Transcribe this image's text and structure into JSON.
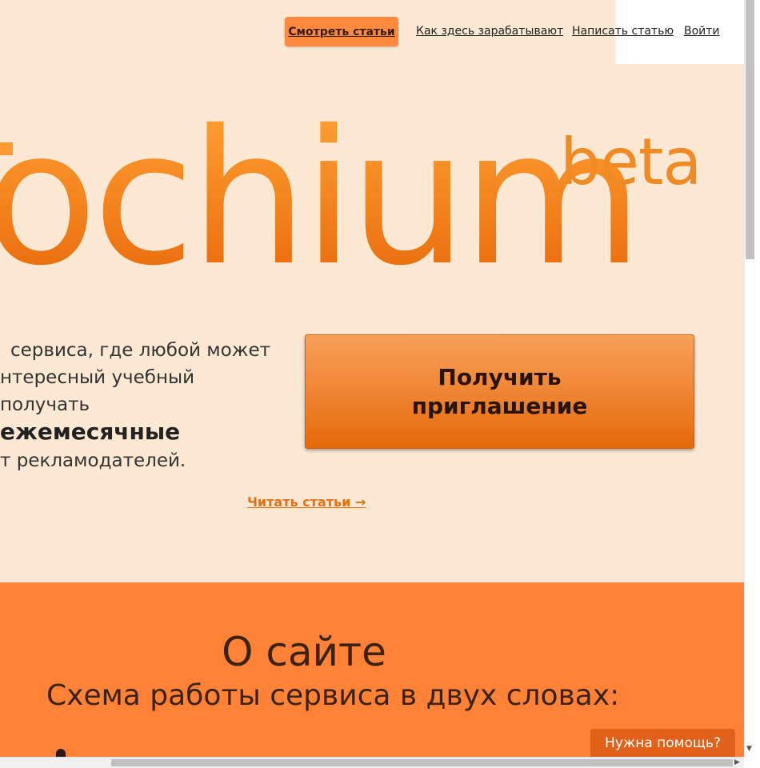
{
  "nav": {
    "active_label": "Смотреть статьи",
    "items": [
      {
        "label": "Как здесь зарабатывают"
      },
      {
        "label": "Написать статью"
      },
      {
        "label": "Войти"
      }
    ]
  },
  "hero": {
    "logo_text": "ochium",
    "beta_label": "beta",
    "intro_line1": "сервиса, где любой может",
    "intro_line2": "нтересный учебный",
    "intro_line3_prefix": "получать ",
    "intro_line3_bold": "ежемесячные",
    "intro_line4": "т рекламодателей.",
    "invite_button_label": "Получить приглашение",
    "read_link_label": "Читать статьи →"
  },
  "about": {
    "title": "О сайте",
    "subtitle": "Схема работы сервиса в двух словах:"
  },
  "help": {
    "label": "Нужна помощь?"
  },
  "colors": {
    "hero_bg": "#fde8d4",
    "accent": "#ff8236",
    "button_orange": "#e56a0a",
    "help_button": "#e2611a"
  },
  "icons": {
    "scroll_down": "triangle-down",
    "scroll_right": "triangle-right"
  }
}
